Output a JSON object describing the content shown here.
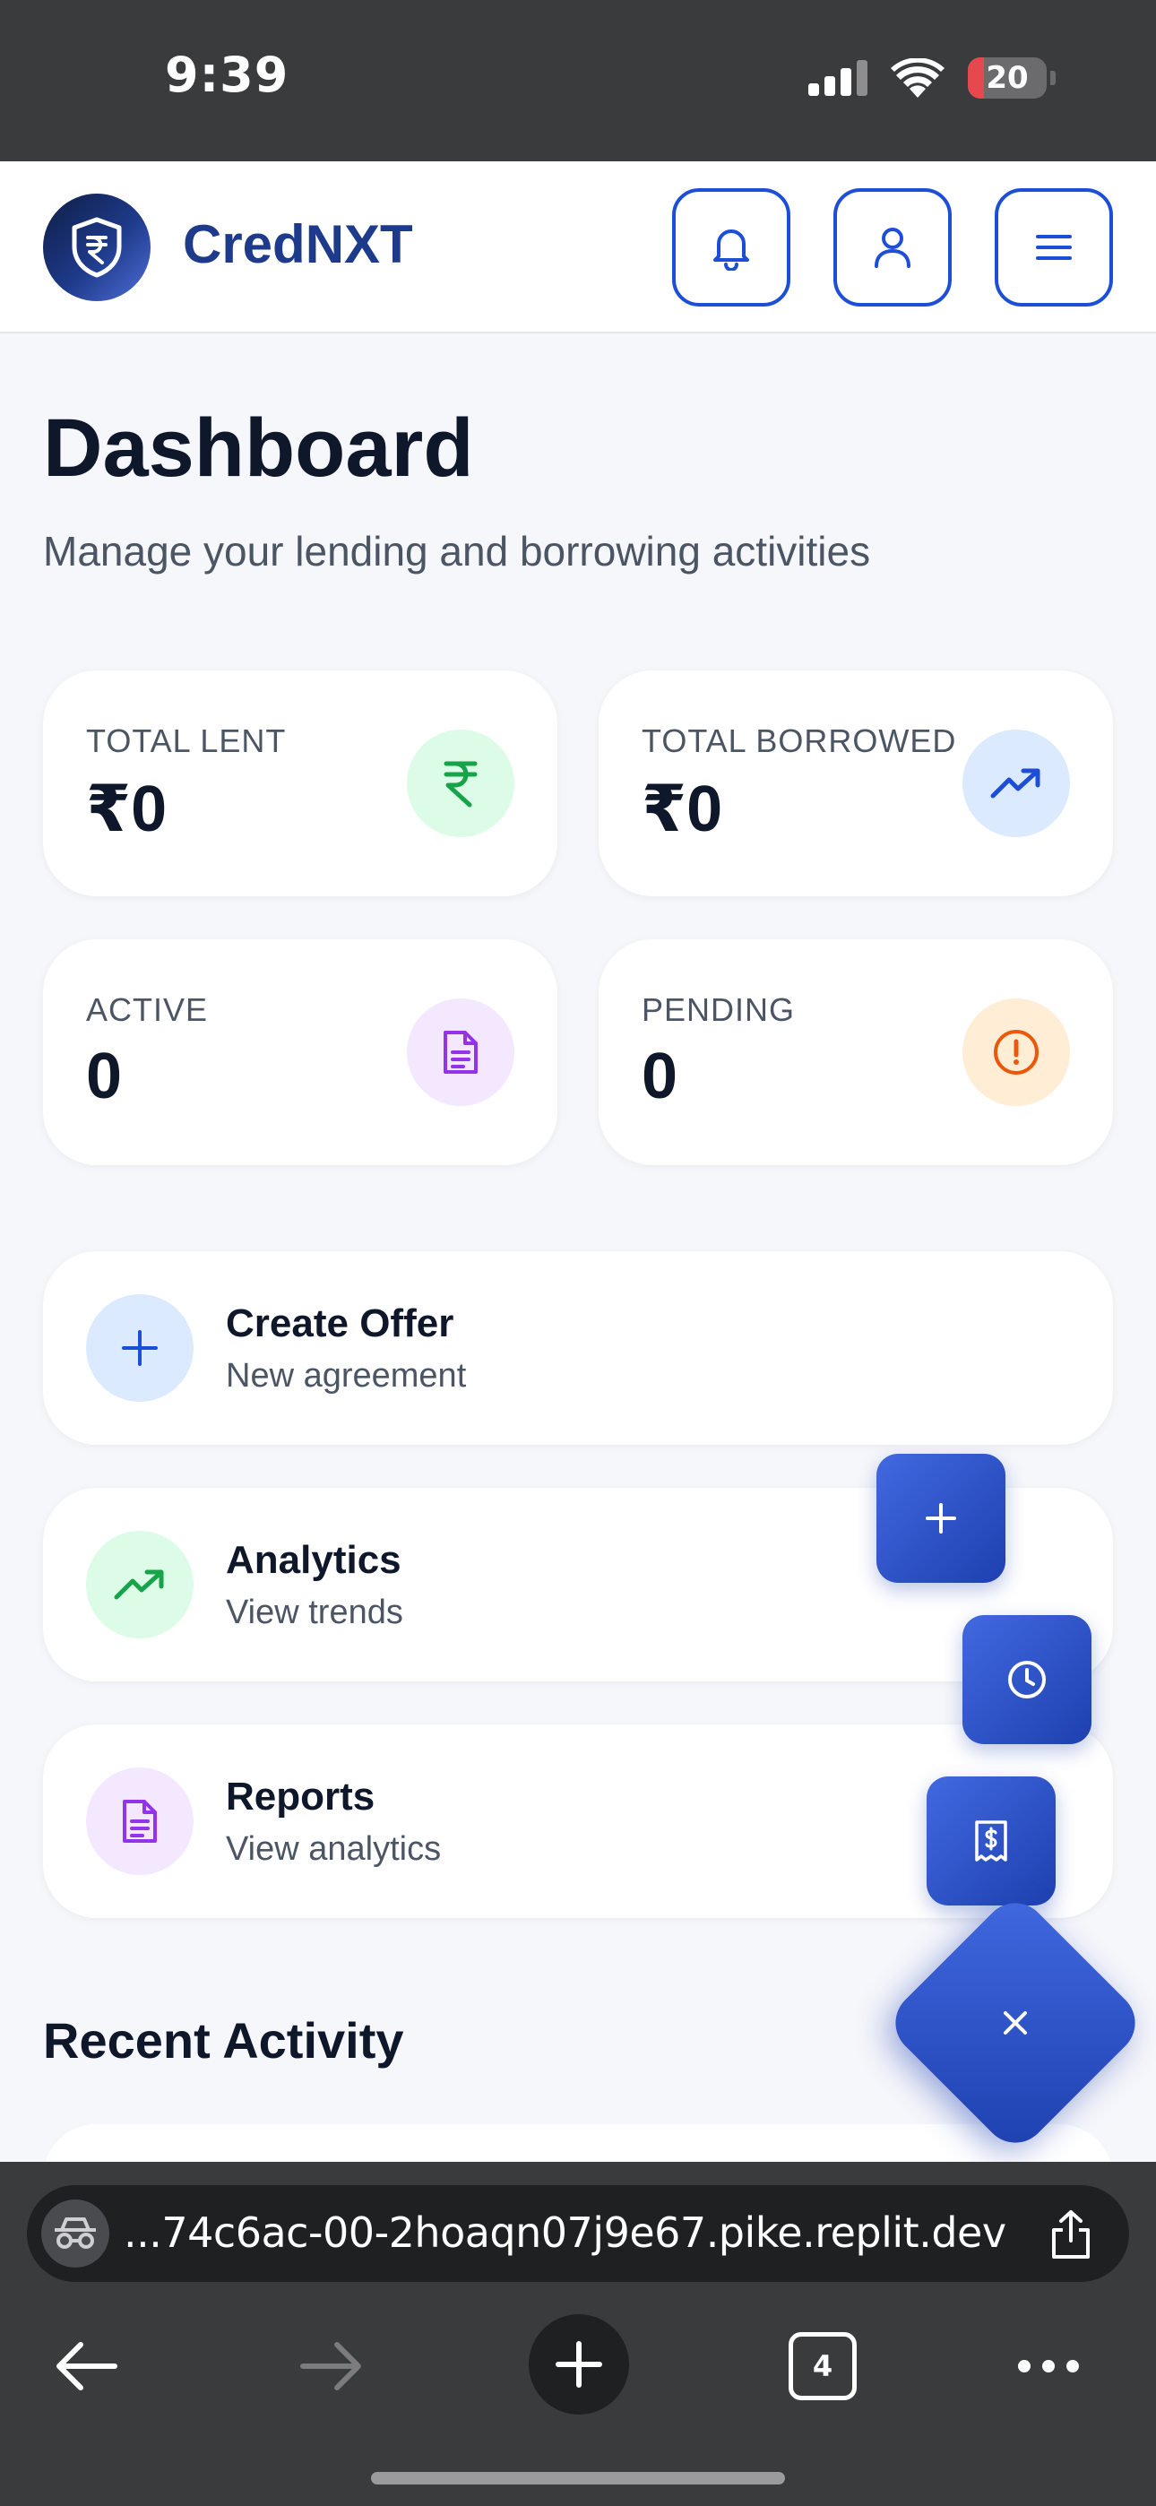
{
  "status_bar": {
    "time": "9:39",
    "battery_level": "20",
    "battery_fraction": 0.2,
    "battery_color": "#e5484d"
  },
  "header": {
    "brand_name": "CredNXT",
    "icons": [
      "shield-rupee-icon",
      "bell-icon",
      "user-icon",
      "menu-icon"
    ]
  },
  "page": {
    "title": "Dashboard",
    "subtitle": "Manage your lending and borrowing activities"
  },
  "stats": [
    {
      "label": "TOTAL LENT",
      "value": "₹0",
      "icon": "rupee-icon",
      "icon_bg": "#dcfce7",
      "icon_color": "#16a34a"
    },
    {
      "label": "TOTAL BORROWED",
      "value": "₹0",
      "icon": "trending-up-icon",
      "icon_bg": "#dbeafe",
      "icon_color": "#1d4ed8"
    },
    {
      "label": "ACTIVE",
      "value": "0",
      "icon": "document-icon",
      "icon_bg": "#f3e8ff",
      "icon_color": "#9333ea"
    },
    {
      "label": "PENDING",
      "value": "0",
      "icon": "alert-circle-icon",
      "icon_bg": "#ffedd5",
      "icon_color": "#ea580c"
    }
  ],
  "actions": [
    {
      "title": "Create Offer",
      "subtitle": "New agreement",
      "icon": "plus-icon",
      "icon_bg": "#dbeafe",
      "icon_color": "#1d4ed8"
    },
    {
      "title": "Analytics",
      "subtitle": "View trends",
      "icon": "trending-up-icon",
      "icon_bg": "#dcfce7",
      "icon_color": "#16a34a"
    },
    {
      "title": "Reports",
      "subtitle": "View analytics",
      "icon": "document-icon",
      "icon_bg": "#f3e8ff",
      "icon_color": "#9333ea"
    }
  ],
  "recent_activity": {
    "title": "Recent Activity"
  },
  "fab_menu": {
    "items": [
      "plus-icon",
      "clock-icon",
      "receipt-icon"
    ],
    "toggle_icon": "close-icon",
    "accent": "#1e40af"
  },
  "browser": {
    "url": "...74c6ac-00-2hoaqn07j9e67.pike.replit.dev",
    "tab_count": "4"
  }
}
